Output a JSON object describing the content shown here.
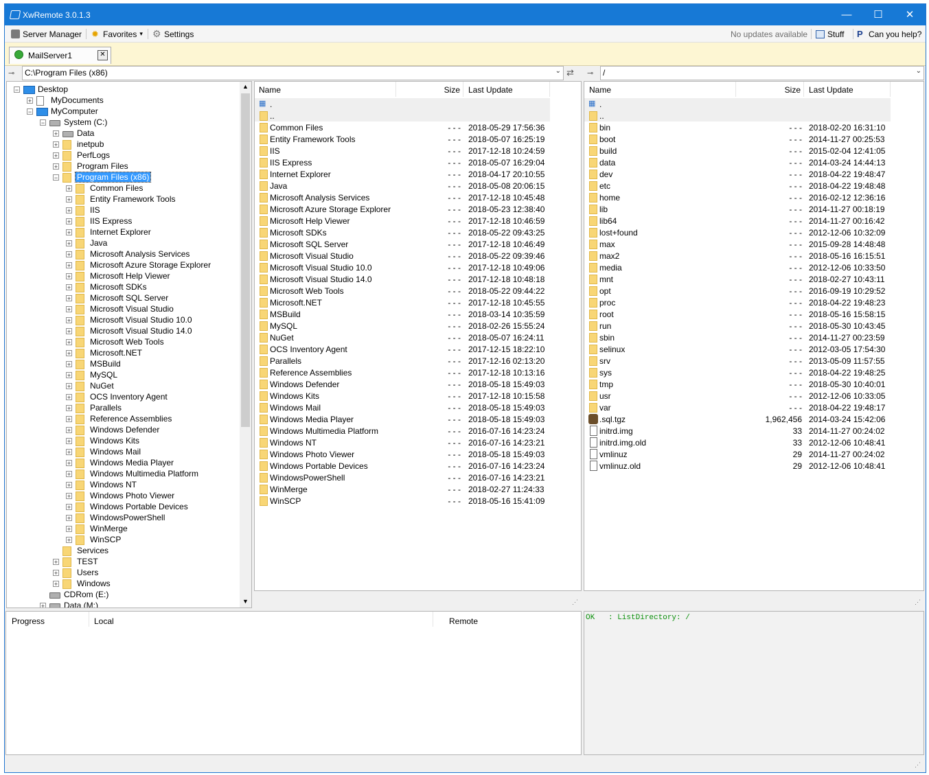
{
  "window": {
    "title": "XwRemote 3.0.1.3"
  },
  "titlebar": {
    "minimize": "—",
    "maximize": "☐",
    "close": "✕"
  },
  "menu": {
    "server_manager": "Server Manager",
    "favorites": "Favorites",
    "favorites_arrow": "▾",
    "settings": "Settings",
    "update_status": "No updates available",
    "stuff": "Stuff",
    "help": "Can you help?"
  },
  "tabs": [
    {
      "label": "MailServer1",
      "close": "✕"
    }
  ],
  "local_path": "C:\\Program Files (x86)",
  "remote_path": "/",
  "columns": {
    "name": "Name",
    "size": "Size",
    "last_update": "Last Update"
  },
  "tree": [
    {
      "label": "Desktop",
      "kind": "desktop",
      "level": 0,
      "exp": "−"
    },
    {
      "label": "MyDocuments",
      "kind": "doc",
      "level": 1,
      "exp": "+"
    },
    {
      "label": "MyComputer",
      "kind": "desktop",
      "level": 1,
      "exp": "−"
    },
    {
      "label": "System (C:)",
      "kind": "disk",
      "level": 2,
      "exp": "−"
    },
    {
      "label": "Data",
      "kind": "disk",
      "level": 3,
      "exp": "+"
    },
    {
      "label": "inetpub",
      "kind": "folder",
      "level": 3,
      "exp": "+"
    },
    {
      "label": "PerfLogs",
      "kind": "folder",
      "level": 3,
      "exp": "+"
    },
    {
      "label": "Program Files",
      "kind": "folder",
      "level": 3,
      "exp": "+"
    },
    {
      "label": "Program Files (x86)",
      "kind": "folder",
      "level": 3,
      "exp": "−",
      "selected": true
    },
    {
      "label": "Common Files",
      "kind": "folder",
      "level": 4,
      "exp": "+"
    },
    {
      "label": "Entity Framework Tools",
      "kind": "folder",
      "level": 4,
      "exp": "+"
    },
    {
      "label": "IIS",
      "kind": "folder",
      "level": 4,
      "exp": "+"
    },
    {
      "label": "IIS Express",
      "kind": "folder",
      "level": 4,
      "exp": "+"
    },
    {
      "label": "Internet Explorer",
      "kind": "folder",
      "level": 4,
      "exp": "+"
    },
    {
      "label": "Java",
      "kind": "folder",
      "level": 4,
      "exp": "+"
    },
    {
      "label": "Microsoft Analysis Services",
      "kind": "folder",
      "level": 4,
      "exp": "+"
    },
    {
      "label": "Microsoft Azure Storage Explorer",
      "kind": "folder",
      "level": 4,
      "exp": "+"
    },
    {
      "label": "Microsoft Help Viewer",
      "kind": "folder",
      "level": 4,
      "exp": "+"
    },
    {
      "label": "Microsoft SDKs",
      "kind": "folder",
      "level": 4,
      "exp": "+"
    },
    {
      "label": "Microsoft SQL Server",
      "kind": "folder",
      "level": 4,
      "exp": "+"
    },
    {
      "label": "Microsoft Visual Studio",
      "kind": "folder",
      "level": 4,
      "exp": "+"
    },
    {
      "label": "Microsoft Visual Studio 10.0",
      "kind": "folder",
      "level": 4,
      "exp": "+"
    },
    {
      "label": "Microsoft Visual Studio 14.0",
      "kind": "folder",
      "level": 4,
      "exp": "+"
    },
    {
      "label": "Microsoft Web Tools",
      "kind": "folder",
      "level": 4,
      "exp": "+"
    },
    {
      "label": "Microsoft.NET",
      "kind": "folder",
      "level": 4,
      "exp": "+"
    },
    {
      "label": "MSBuild",
      "kind": "folder",
      "level": 4,
      "exp": "+"
    },
    {
      "label": "MySQL",
      "kind": "folder",
      "level": 4,
      "exp": "+"
    },
    {
      "label": "NuGet",
      "kind": "folder",
      "level": 4,
      "exp": "+"
    },
    {
      "label": "OCS Inventory Agent",
      "kind": "folder",
      "level": 4,
      "exp": "+"
    },
    {
      "label": "Parallels",
      "kind": "folder",
      "level": 4,
      "exp": "+"
    },
    {
      "label": "Reference Assemblies",
      "kind": "folder",
      "level": 4,
      "exp": "+"
    },
    {
      "label": "Windows Defender",
      "kind": "folder",
      "level": 4,
      "exp": "+"
    },
    {
      "label": "Windows Kits",
      "kind": "folder",
      "level": 4,
      "exp": "+"
    },
    {
      "label": "Windows Mail",
      "kind": "folder",
      "level": 4,
      "exp": "+"
    },
    {
      "label": "Windows Media Player",
      "kind": "folder",
      "level": 4,
      "exp": "+"
    },
    {
      "label": "Windows Multimedia Platform",
      "kind": "folder",
      "level": 4,
      "exp": "+"
    },
    {
      "label": "Windows NT",
      "kind": "folder",
      "level": 4,
      "exp": "+"
    },
    {
      "label": "Windows Photo Viewer",
      "kind": "folder",
      "level": 4,
      "exp": "+"
    },
    {
      "label": "Windows Portable Devices",
      "kind": "folder",
      "level": 4,
      "exp": "+"
    },
    {
      "label": "WindowsPowerShell",
      "kind": "folder",
      "level": 4,
      "exp": "+"
    },
    {
      "label": "WinMerge",
      "kind": "folder",
      "level": 4,
      "exp": "+"
    },
    {
      "label": "WinSCP",
      "kind": "folder",
      "level": 4,
      "exp": "+"
    },
    {
      "label": "Services",
      "kind": "folder",
      "level": 3,
      "exp": ""
    },
    {
      "label": "TEST",
      "kind": "folder",
      "level": 3,
      "exp": "+"
    },
    {
      "label": "Users",
      "kind": "folder",
      "level": 3,
      "exp": "+"
    },
    {
      "label": "Windows",
      "kind": "folder",
      "level": 3,
      "exp": "+"
    },
    {
      "label": "CDRom (E:)",
      "kind": "disk",
      "level": 2,
      "exp": ""
    },
    {
      "label": "Data (M:)",
      "kind": "disk",
      "level": 2,
      "exp": "+"
    }
  ],
  "local_files": [
    {
      "name": ".",
      "kind": "up",
      "size": "",
      "date": ""
    },
    {
      "name": "..",
      "kind": "folder",
      "size": "",
      "date": ""
    },
    {
      "name": "Common Files",
      "kind": "folder",
      "size": "- - -",
      "date": "2018-05-29 17:56:36"
    },
    {
      "name": "Entity Framework Tools",
      "kind": "folder",
      "size": "- - -",
      "date": "2018-05-07 16:25:19"
    },
    {
      "name": "IIS",
      "kind": "folder",
      "size": "- - -",
      "date": "2017-12-18 10:24:59"
    },
    {
      "name": "IIS Express",
      "kind": "folder",
      "size": "- - -",
      "date": "2018-05-07 16:29:04"
    },
    {
      "name": "Internet Explorer",
      "kind": "folder",
      "size": "- - -",
      "date": "2018-04-17 20:10:55"
    },
    {
      "name": "Java",
      "kind": "folder",
      "size": "- - -",
      "date": "2018-05-08 20:06:15"
    },
    {
      "name": "Microsoft Analysis Services",
      "kind": "folder",
      "size": "- - -",
      "date": "2017-12-18 10:45:48"
    },
    {
      "name": "Microsoft Azure Storage Explorer",
      "kind": "folder",
      "size": "- - -",
      "date": "2018-05-23 12:38:40"
    },
    {
      "name": "Microsoft Help Viewer",
      "kind": "folder",
      "size": "- - -",
      "date": "2017-12-18 10:46:59"
    },
    {
      "name": "Microsoft SDKs",
      "kind": "folder",
      "size": "- - -",
      "date": "2018-05-22 09:43:25"
    },
    {
      "name": "Microsoft SQL Server",
      "kind": "folder",
      "size": "- - -",
      "date": "2017-12-18 10:46:49"
    },
    {
      "name": "Microsoft Visual Studio",
      "kind": "folder",
      "size": "- - -",
      "date": "2018-05-22 09:39:46"
    },
    {
      "name": "Microsoft Visual Studio 10.0",
      "kind": "folder",
      "size": "- - -",
      "date": "2017-12-18 10:49:06"
    },
    {
      "name": "Microsoft Visual Studio 14.0",
      "kind": "folder",
      "size": "- - -",
      "date": "2017-12-18 10:48:18"
    },
    {
      "name": "Microsoft Web Tools",
      "kind": "folder",
      "size": "- - -",
      "date": "2018-05-22 09:44:22"
    },
    {
      "name": "Microsoft.NET",
      "kind": "folder",
      "size": "- - -",
      "date": "2017-12-18 10:45:55"
    },
    {
      "name": "MSBuild",
      "kind": "folder",
      "size": "- - -",
      "date": "2018-03-14 10:35:59"
    },
    {
      "name": "MySQL",
      "kind": "folder",
      "size": "- - -",
      "date": "2018-02-26 15:55:24"
    },
    {
      "name": "NuGet",
      "kind": "folder",
      "size": "- - -",
      "date": "2018-05-07 16:24:11"
    },
    {
      "name": "OCS Inventory Agent",
      "kind": "folder",
      "size": "- - -",
      "date": "2017-12-15 18:22:10"
    },
    {
      "name": "Parallels",
      "kind": "folder",
      "size": "- - -",
      "date": "2017-12-16 02:13:20"
    },
    {
      "name": "Reference Assemblies",
      "kind": "folder",
      "size": "- - -",
      "date": "2017-12-18 10:13:16"
    },
    {
      "name": "Windows Defender",
      "kind": "folder",
      "size": "- - -",
      "date": "2018-05-18 15:49:03"
    },
    {
      "name": "Windows Kits",
      "kind": "folder",
      "size": "- - -",
      "date": "2017-12-18 10:15:58"
    },
    {
      "name": "Windows Mail",
      "kind": "folder",
      "size": "- - -",
      "date": "2018-05-18 15:49:03"
    },
    {
      "name": "Windows Media Player",
      "kind": "folder",
      "size": "- - -",
      "date": "2018-05-18 15:49:03"
    },
    {
      "name": "Windows Multimedia Platform",
      "kind": "folder",
      "size": "- - -",
      "date": "2016-07-16 14:23:24"
    },
    {
      "name": "Windows NT",
      "kind": "folder",
      "size": "- - -",
      "date": "2016-07-16 14:23:21"
    },
    {
      "name": "Windows Photo Viewer",
      "kind": "folder",
      "size": "- - -",
      "date": "2018-05-18 15:49:03"
    },
    {
      "name": "Windows Portable Devices",
      "kind": "folder",
      "size": "- - -",
      "date": "2016-07-16 14:23:24"
    },
    {
      "name": "WindowsPowerShell",
      "kind": "folder",
      "size": "- - -",
      "date": "2016-07-16 14:23:21"
    },
    {
      "name": "WinMerge",
      "kind": "folder",
      "size": "- - -",
      "date": "2018-02-27 11:24:33"
    },
    {
      "name": "WinSCP",
      "kind": "folder",
      "size": "- - -",
      "date": "2018-05-16 15:41:09"
    }
  ],
  "remote_files": [
    {
      "name": ".",
      "kind": "up",
      "size": "",
      "date": ""
    },
    {
      "name": "..",
      "kind": "folder",
      "size": "",
      "date": ""
    },
    {
      "name": "bin",
      "kind": "folder",
      "size": "- - -",
      "date": "2018-02-20 16:31:10"
    },
    {
      "name": "boot",
      "kind": "folder",
      "size": "- - -",
      "date": "2014-11-27 00:25:53"
    },
    {
      "name": "build",
      "kind": "folder",
      "size": "- - -",
      "date": "2015-02-04 12:41:05"
    },
    {
      "name": "data",
      "kind": "folder",
      "size": "- - -",
      "date": "2014-03-24 14:44:13"
    },
    {
      "name": "dev",
      "kind": "folder",
      "size": "- - -",
      "date": "2018-04-22 19:48:47"
    },
    {
      "name": "etc",
      "kind": "folder",
      "size": "- - -",
      "date": "2018-04-22 19:48:48"
    },
    {
      "name": "home",
      "kind": "folder",
      "size": "- - -",
      "date": "2016-02-12 12:36:16"
    },
    {
      "name": "lib",
      "kind": "folder",
      "size": "- - -",
      "date": "2014-11-27 00:18:19"
    },
    {
      "name": "lib64",
      "kind": "folder",
      "size": "- - -",
      "date": "2014-11-27 00:16:42"
    },
    {
      "name": "lost+found",
      "kind": "folder",
      "size": "- - -",
      "date": "2012-12-06 10:32:09"
    },
    {
      "name": "max",
      "kind": "folder",
      "size": "- - -",
      "date": "2015-09-28 14:48:48"
    },
    {
      "name": "max2",
      "kind": "folder",
      "size": "- - -",
      "date": "2018-05-16 16:15:51"
    },
    {
      "name": "media",
      "kind": "folder",
      "size": "- - -",
      "date": "2012-12-06 10:33:50"
    },
    {
      "name": "mnt",
      "kind": "folder",
      "size": "- - -",
      "date": "2018-02-27 10:43:11"
    },
    {
      "name": "opt",
      "kind": "folder",
      "size": "- - -",
      "date": "2016-09-19 10:29:52"
    },
    {
      "name": "proc",
      "kind": "folder",
      "size": "- - -",
      "date": "2018-04-22 19:48:23"
    },
    {
      "name": "root",
      "kind": "folder",
      "size": "- - -",
      "date": "2018-05-16 15:58:15"
    },
    {
      "name": "run",
      "kind": "folder",
      "size": "- - -",
      "date": "2018-05-30 10:43:45"
    },
    {
      "name": "sbin",
      "kind": "folder",
      "size": "- - -",
      "date": "2014-11-27 00:23:59"
    },
    {
      "name": "selinux",
      "kind": "folder",
      "size": "- - -",
      "date": "2012-03-05 17:54:30"
    },
    {
      "name": "srv",
      "kind": "folder",
      "size": "- - -",
      "date": "2013-05-09 11:57:55"
    },
    {
      "name": "sys",
      "kind": "folder",
      "size": "- - -",
      "date": "2018-04-22 19:48:25"
    },
    {
      "name": "tmp",
      "kind": "folder",
      "size": "- - -",
      "date": "2018-05-30 10:40:01"
    },
    {
      "name": "usr",
      "kind": "folder",
      "size": "- - -",
      "date": "2012-12-06 10:33:05"
    },
    {
      "name": "var",
      "kind": "folder",
      "size": "- - -",
      "date": "2018-04-22 19:48:17"
    },
    {
      "name": ".sql.tgz",
      "kind": "archive",
      "size": "1,962,456",
      "date": "2014-03-24 15:42:06"
    },
    {
      "name": "initrd.img",
      "kind": "file",
      "size": "33",
      "date": "2014-11-27 00:24:02"
    },
    {
      "name": "initrd.img.old",
      "kind": "file",
      "size": "33",
      "date": "2012-12-06 10:48:41"
    },
    {
      "name": "vmlinuz",
      "kind": "file",
      "size": "29",
      "date": "2014-11-27 00:24:02"
    },
    {
      "name": "vmlinuz.old",
      "kind": "file",
      "size": "29",
      "date": "2012-12-06 10:48:41"
    }
  ],
  "transfers": {
    "col_progress": "Progress",
    "col_local": "Local",
    "col_remote": "Remote"
  },
  "log": {
    "line1": "OK   : ListDirectory: /"
  },
  "icons": {
    "sync": "⇄",
    "pin": "⊸",
    "grip": "⋰",
    "dropdown": "⌄"
  }
}
